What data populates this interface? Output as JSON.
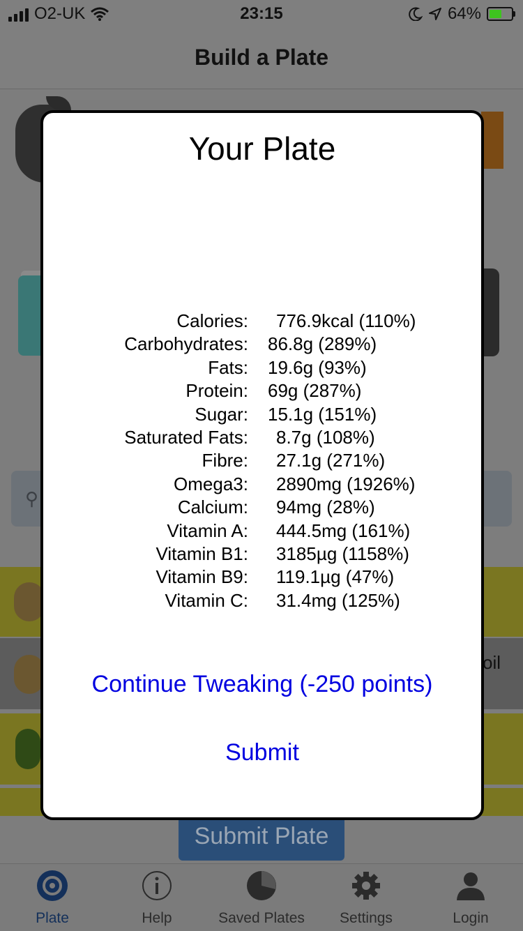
{
  "status_bar": {
    "carrier": "O2-UK",
    "time": "23:15",
    "battery": "64%",
    "battery_level": 0.64
  },
  "nav": {
    "title": "Build a Plate"
  },
  "background": {
    "partial_text": "oil",
    "submit_plate": "Submit Plate"
  },
  "modal": {
    "title": "Your Plate",
    "nutrients": [
      {
        "label": "Calories:",
        "value": "776.9kcal (110%)"
      },
      {
        "label": "Carbohydrates:",
        "value": "86.8g (289%)"
      },
      {
        "label": "Fats:",
        "value": "19.6g (93%)"
      },
      {
        "label": "Protein:",
        "value": "69g (287%)"
      },
      {
        "label": "Sugar:",
        "value": "15.1g (151%)"
      },
      {
        "label": "Saturated Fats:",
        "value": "8.7g (108%)"
      },
      {
        "label": "Fibre:",
        "value": "27.1g (271%)"
      },
      {
        "label": "Omega3:",
        "value": "2890mg (1926%)"
      },
      {
        "label": "Calcium:",
        "value": "94mg (28%)"
      },
      {
        "label": "Vitamin A:",
        "value": "444.5mg (161%)"
      },
      {
        "label": "Vitamin B1:",
        "value": "3185µg (1158%)"
      },
      {
        "label": "Vitamin B9:",
        "value": "119.1µg (47%)"
      },
      {
        "label": "Vitamin C:",
        "value": "31.4mg (125%)"
      }
    ],
    "continue_label": "Continue Tweaking (-250 points)",
    "submit_label": "Submit"
  },
  "tabs": [
    {
      "label": "Plate",
      "icon": "target-icon",
      "active": true
    },
    {
      "label": "Help",
      "icon": "info-icon",
      "active": false
    },
    {
      "label": "Saved Plates",
      "icon": "pie-chart-icon",
      "active": false
    },
    {
      "label": "Settings",
      "icon": "gear-icon",
      "active": false
    },
    {
      "label": "Login",
      "icon": "user-icon",
      "active": false
    }
  ],
  "colors": {
    "link": "#0000e0",
    "active_tab": "#14305a",
    "battery_fill": "#3ec41f"
  }
}
